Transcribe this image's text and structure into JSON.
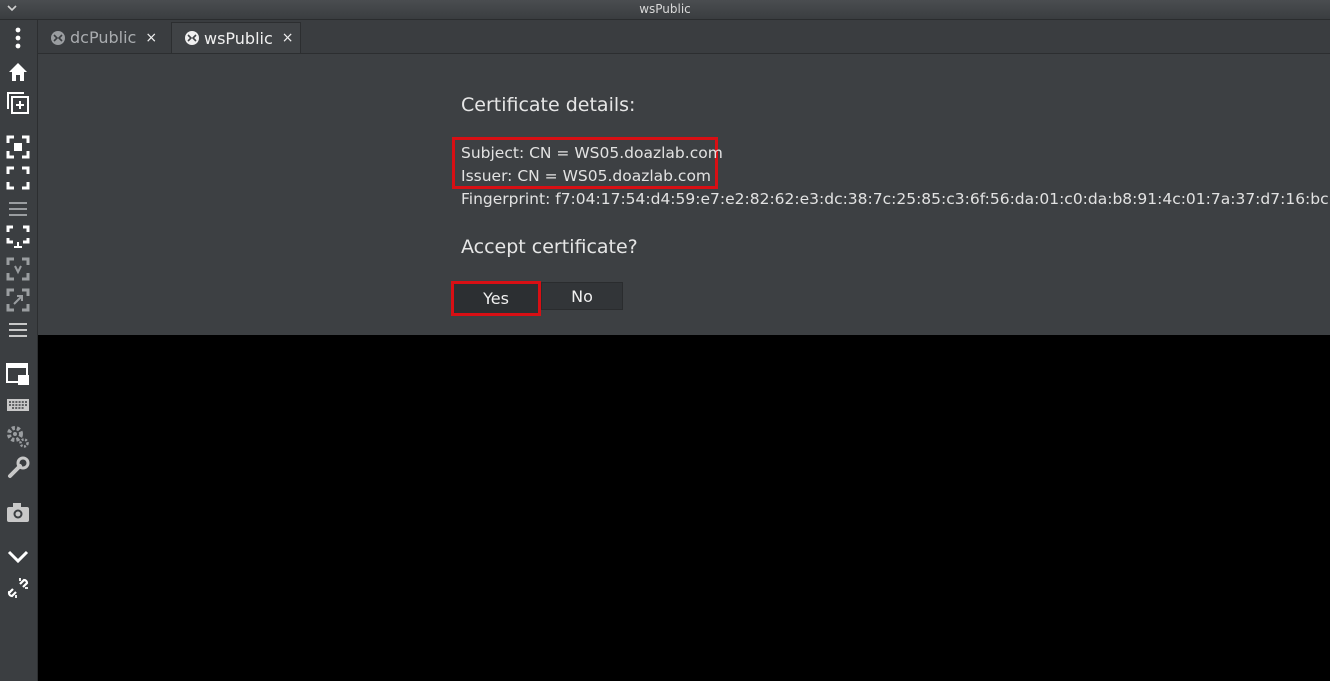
{
  "window": {
    "title": "wsPublic"
  },
  "tabs": [
    {
      "label": "dcPublic",
      "close": "×",
      "active": false
    },
    {
      "label": "wsPublic",
      "close": "×",
      "active": true
    }
  ],
  "sidebar": {
    "icons": [
      "more-vert-icon",
      "home-icon",
      "new-window-icon",
      "fit-window-icon",
      "fullscreen-icon",
      "menu-icon",
      "display-icon",
      "scale-icon",
      "expand-icon",
      "menu-icon",
      "multi-monitor-icon",
      "keyboard-icon",
      "preferences-icon",
      "tools-icon",
      "screenshot-icon",
      "minimize-icon",
      "disconnect-icon"
    ]
  },
  "dialog": {
    "heading": "Certificate details:",
    "subject": "Subject: CN = WS05.doazlab.com",
    "issuer": "Issuer: CN = WS05.doazlab.com",
    "fingerprint": "Fingerprint: f7:04:17:54:d4:59:e7:e2:82:62:e3:dc:38:7c:25:85:c3:6f:56:da:01:c0:da:b8:91:4c:01:7a:37:d7:16:bc",
    "question": "Accept certificate?",
    "yes": "Yes",
    "no": "No"
  },
  "colors": {
    "highlight": "#d80f14",
    "panel": "#3d4043",
    "sidebar": "#3b3e41"
  }
}
